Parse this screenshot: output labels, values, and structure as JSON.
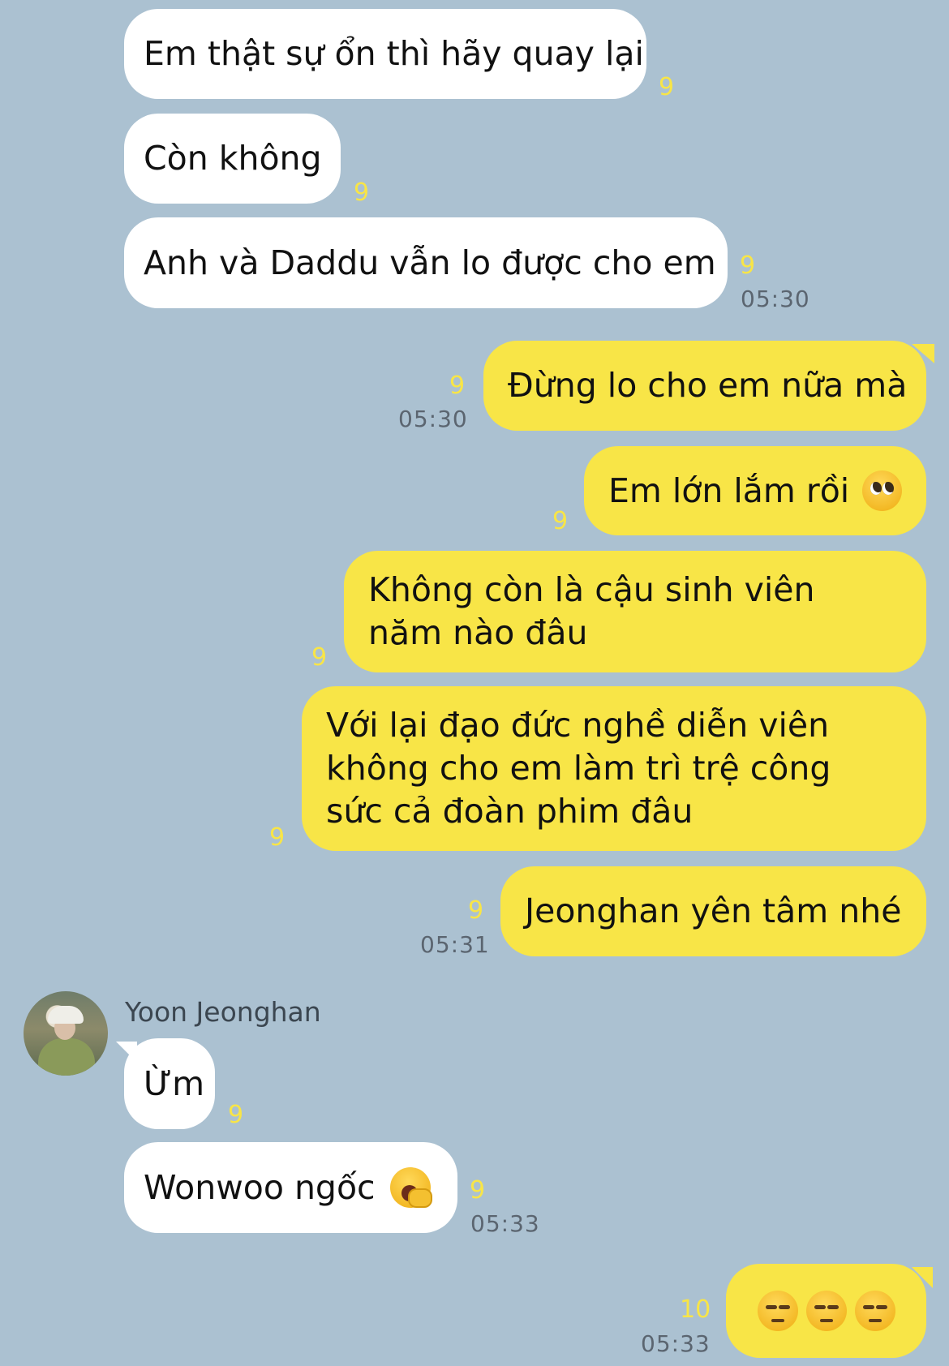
{
  "colors": {
    "background": "#abc1d1",
    "incoming_bubble": "#ffffff",
    "outgoing_bubble": "#f8e547",
    "read_count": "#f8e547"
  },
  "contact": {
    "name": "Yoon Jeonghan"
  },
  "messages": [
    {
      "dir": "in",
      "text": "Em thật sự ổn thì hãy quay lại",
      "read": "9"
    },
    {
      "dir": "in",
      "text": "Còn không",
      "read": "9"
    },
    {
      "dir": "in",
      "text": "Anh và Daddu vẫn lo được cho em",
      "read": "9",
      "time": "05:30"
    },
    {
      "dir": "out",
      "text": "Đừng lo cho em nữa mà",
      "read": "9",
      "time": "05:30"
    },
    {
      "dir": "out",
      "text": "Em lớn lắm rồi",
      "emoji": "pleading-face-icon",
      "read": "9"
    },
    {
      "dir": "out",
      "text": "Không còn là cậu sinh viên năm nào đâu",
      "read": "9"
    },
    {
      "dir": "out",
      "text": "Với lại đạo đức nghề diễn viên không cho em làm trì trệ công sức cả đoàn phim đâu",
      "read": "9"
    },
    {
      "dir": "out",
      "text": "Jeonghan yên tâm nhé",
      "read": "9",
      "time": "05:31"
    },
    {
      "dir": "in",
      "text": "Ừm",
      "read": "9"
    },
    {
      "dir": "in",
      "text": "Wonwoo ngốc",
      "emoji": "yawning-face-icon",
      "read": "9",
      "time": "05:33"
    },
    {
      "dir": "out",
      "text": "",
      "emoji": "unamused-face-icon x3",
      "read": "10",
      "time": "05:33"
    }
  ]
}
